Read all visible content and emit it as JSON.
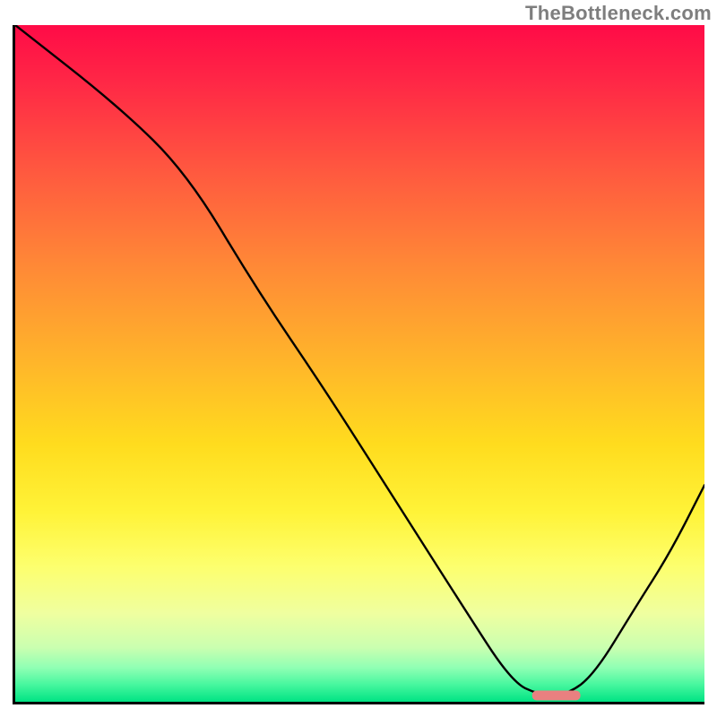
{
  "watermark": "TheBottleneck.com",
  "chart_data": {
    "type": "line",
    "title": "",
    "xlabel": "",
    "ylabel": "",
    "xlim": [
      0,
      100
    ],
    "ylim": [
      0,
      100
    ],
    "grid": false,
    "legend": false,
    "background": "vertical-gradient-red-yellow-green",
    "series": [
      {
        "name": "bottleneck-curve",
        "x": [
          0,
          15,
          25,
          35,
          45,
          55,
          65,
          72,
          76,
          80,
          84,
          90,
          95,
          100
        ],
        "values": [
          100,
          88,
          78,
          61,
          46,
          30,
          14,
          3,
          1,
          1,
          4,
          14,
          22,
          32
        ]
      }
    ],
    "marker": {
      "name": "optimal-range",
      "x_start": 75,
      "x_end": 82,
      "y": 1,
      "color": "#e98080"
    }
  }
}
